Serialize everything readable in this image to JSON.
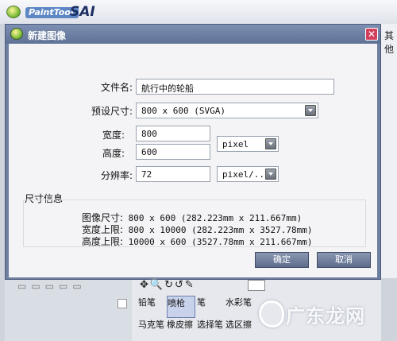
{
  "app": {
    "title_small": "PaintTool",
    "title_big": "SAI",
    "right_text": "其他"
  },
  "dialog": {
    "title": "新建图像",
    "close_label": "✕",
    "file_name_label": "文件名:",
    "file_name_value": "航行中的轮船",
    "preset_label": "预设尺寸:",
    "preset_value": "800 x 600 (SVGA)",
    "width_label": "宽度:",
    "width_value": "800",
    "height_label": "高度:",
    "height_value": "600",
    "unit_value": "pixel",
    "resolution_label": "分辨率:",
    "resolution_value": "72",
    "resolution_unit_value": "pixel/...",
    "info_header": "尺寸信息",
    "info_rows": [
      {
        "key": "图像尺寸:",
        "value": "800 x 600 (282.223mm x 211.667mm)"
      },
      {
        "key": "宽度上限:",
        "value": "800 x 10000 (282.223mm x 3527.78mm)"
      },
      {
        "key": "高度上限:",
        "value": "10000 x 600 (3527.78mm x 211.667mm)"
      }
    ],
    "ok_label": "确定",
    "cancel_label": "取消"
  },
  "tools": {
    "row1": [
      "铅笔",
      "喷枪",
      "笔",
      "水彩笔"
    ],
    "row2": [
      "马克笔",
      "橡皮擦",
      "选择笔",
      "选区擦"
    ],
    "toolbar_icons": "✥🔍↻↺✎"
  },
  "watermark": {
    "text": "广东龙网"
  }
}
